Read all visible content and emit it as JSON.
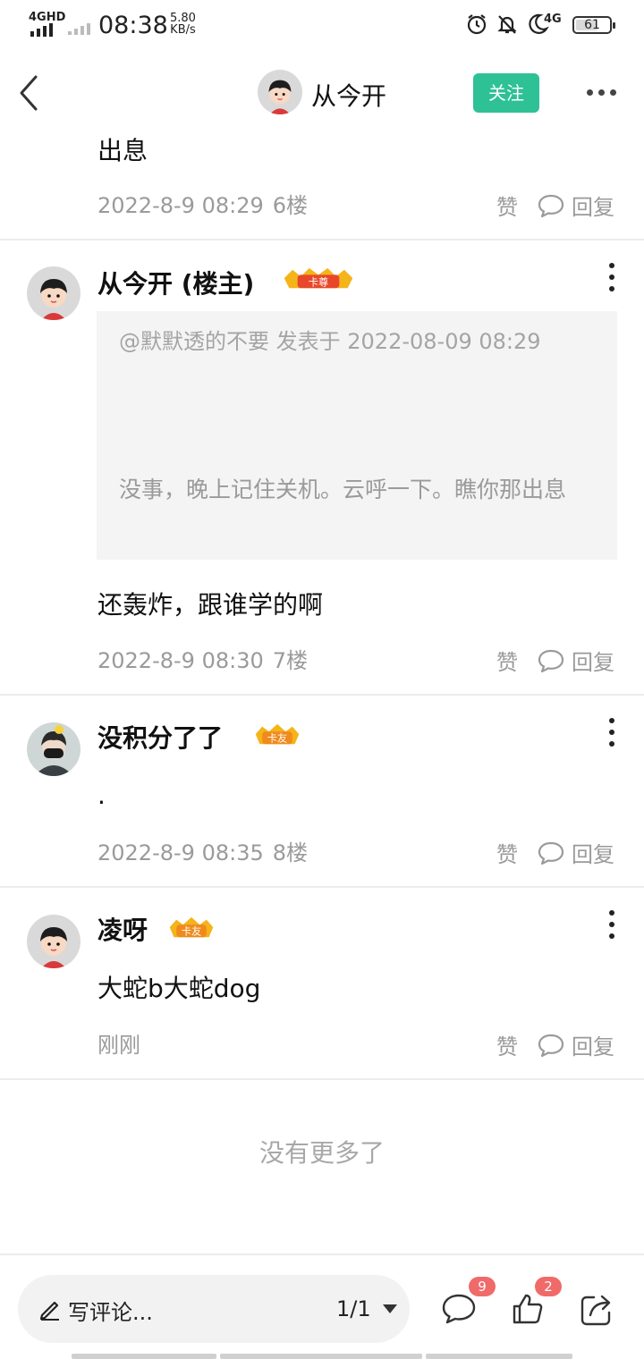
{
  "status_bar": {
    "network": "4GHD",
    "time": "08:38",
    "speed_value": "5.80",
    "speed_unit": "KB/s",
    "network2": "4G",
    "battery": "61"
  },
  "header": {
    "title": "从今开",
    "follow_label": "关注"
  },
  "posts": [
    {
      "partial_content": "出息",
      "date": "2022-8-9 08:29",
      "floor": "6楼",
      "like_label": "赞",
      "reply_label": "回复"
    },
    {
      "author": "从今开 (楼主)",
      "badge": "卡尊",
      "quote_header": "@默默透的不要 发表于 2022-08-09 08:29",
      "quote_text": "没事，晚上记住关机。云呼一下。瞧你那出息",
      "content": "还轰炸，跟谁学的啊",
      "date": "2022-8-9 08:30",
      "floor": "7楼",
      "like_label": "赞",
      "reply_label": "回复"
    },
    {
      "author": "没积分了了",
      "badge": "卡友",
      "content": ".",
      "date": "2022-8-9 08:35",
      "floor": "8楼",
      "like_label": "赞",
      "reply_label": "回复"
    },
    {
      "author": "凌呀",
      "badge": "卡友",
      "content": "大蛇b大蛇dog",
      "date": "刚刚",
      "like_label": "赞",
      "reply_label": "回复"
    }
  ],
  "footer_text": "没有更多了",
  "bottom_bar": {
    "comment_placeholder": "写评论...",
    "page_indicator": "1/1",
    "comment_count": "9",
    "like_count": "2"
  },
  "colors": {
    "accent": "#2ec196",
    "badge_red": "#f06a6a",
    "meta_gray": "#9a9a9a",
    "quote_bg": "#f4f4f4"
  },
  "icons": [
    "back-arrow-icon",
    "more-dots-icon",
    "kebab-menu-icon",
    "reply-bubble-icon",
    "pen-icon",
    "dropdown-caret-icon",
    "comment-icon",
    "thumbs-up-icon",
    "share-icon",
    "alarm-icon",
    "mute-bell-icon",
    "moon-icon"
  ]
}
